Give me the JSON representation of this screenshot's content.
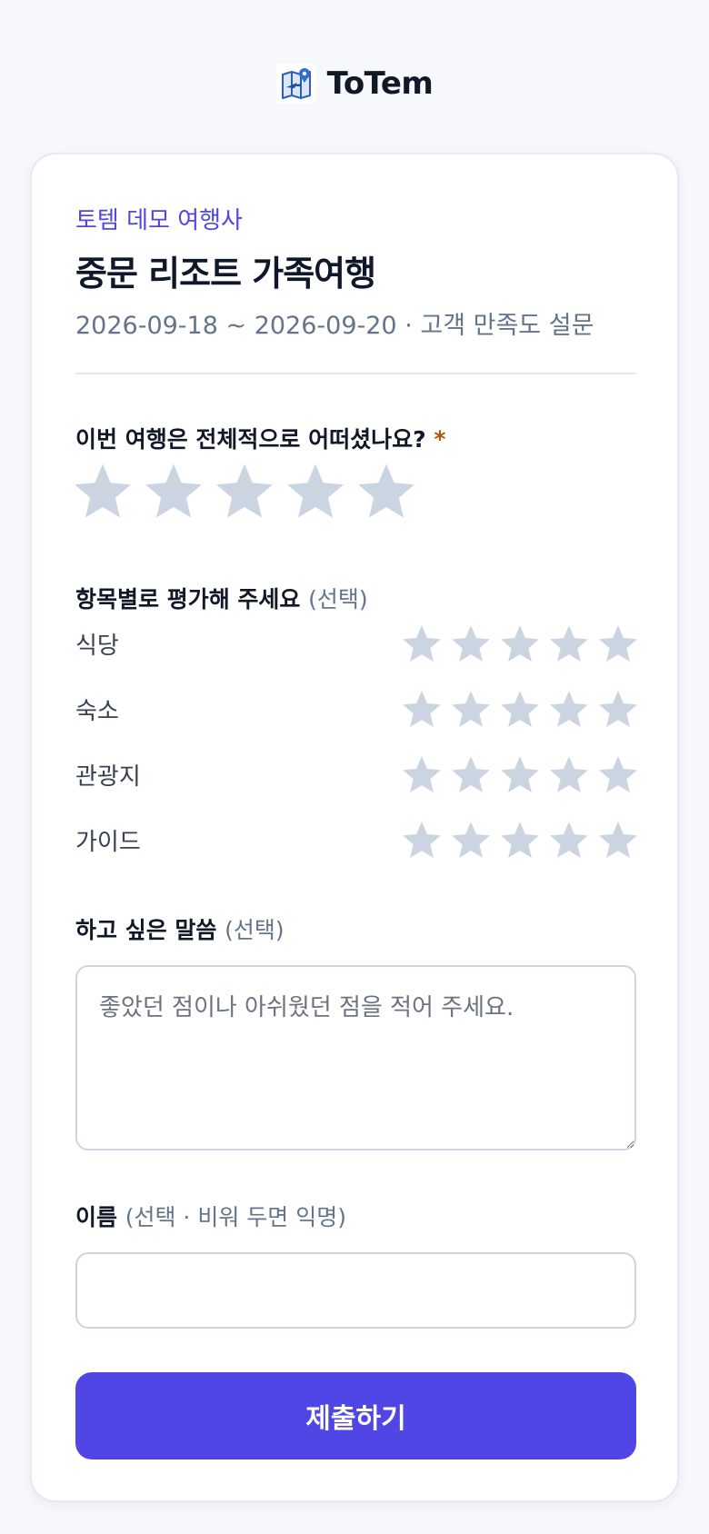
{
  "brand": {
    "name": "ToTem"
  },
  "survey": {
    "agency": "토템 데모 여행사",
    "title": "중문 리조트 가족여행",
    "subtitle": "2026-09-18 ~ 2026-09-20 · 고객 만족도 설문"
  },
  "overall": {
    "question": "이번 여행은 전체적으로 어떠셨나요?",
    "required_mark": "*",
    "rating": 0,
    "max": 5
  },
  "categories": {
    "label": "항목별로 평가해 주세요",
    "optional": "(선택)",
    "items": [
      {
        "label": "식당",
        "rating": 0
      },
      {
        "label": "숙소",
        "rating": 0
      },
      {
        "label": "관광지",
        "rating": 0
      },
      {
        "label": "가이드",
        "rating": 0
      }
    ]
  },
  "comment": {
    "label": "하고 싶은 말씀",
    "optional": "(선택)",
    "placeholder": "좋았던 점이나 아쉬웠던 점을 적어 주세요.",
    "value": ""
  },
  "name": {
    "label": "이름",
    "optional": "(선택 · 비워 두면 익명)",
    "value": ""
  },
  "submit_label": "제출하기",
  "colors": {
    "accent": "#4f46e5",
    "star_empty": "#cbd5e1",
    "required": "#b45309",
    "background": "#f6f8fc"
  },
  "icons": {
    "logo": "map-pin-plane-icon",
    "star": "star-icon"
  }
}
